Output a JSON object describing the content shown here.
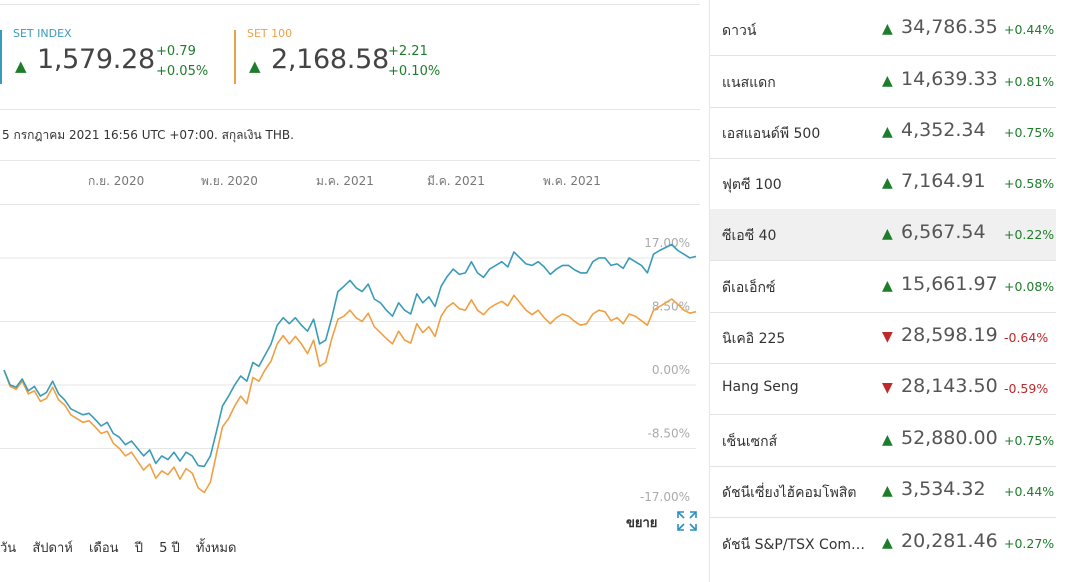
{
  "header": {
    "indices": [
      {
        "name": "SET INDEX",
        "value": "1,579.28",
        "change": "+0.79",
        "change_pct": "+0.05%",
        "color": "#3a9bb8",
        "direction": "up"
      },
      {
        "name": "SET 100",
        "value": "2,168.58",
        "change": "+2.21",
        "change_pct": "+0.10%",
        "color": "#f0a044",
        "direction": "up"
      }
    ],
    "note": "5 กรกฎาคม 2021 16:56 UTC +07:00. สกุลเงิน THB."
  },
  "chart_data": {
    "type": "line",
    "x_tick_labels": [
      "ก.ย. 2020",
      "พ.ย. 2020",
      "ม.ค. 2021",
      "มี.ค. 2021",
      "พ.ค. 2021"
    ],
    "y_tick_labels": [
      "17.00%",
      "8.50%",
      "0.00%",
      "-8.50%",
      "-17.00%"
    ],
    "ylim": [
      -17,
      17
    ],
    "grid": true,
    "series": [
      {
        "name": "SET INDEX",
        "color": "#3a9bb8",
        "values": [
          0.0,
          -2.0,
          -2.3,
          -1.2,
          -2.8,
          -2.2,
          -3.5,
          -3.0,
          -1.5,
          -3.2,
          -4.0,
          -5.2,
          -5.6,
          -6.0,
          -5.8,
          -6.6,
          -7.5,
          -7.0,
          -8.5,
          -9.0,
          -10.0,
          -9.5,
          -10.5,
          -11.5,
          -10.7,
          -12.5,
          -11.5,
          -12.0,
          -11.0,
          -12.2,
          -11.0,
          -11.5,
          -12.8,
          -12.9,
          -11.5,
          -8.2,
          -4.8,
          -3.5,
          -2.0,
          -0.8,
          -1.5,
          1.0,
          0.5,
          2.0,
          3.5,
          6.0,
          7.0,
          6.2,
          7.0,
          6.0,
          5.2,
          6.8,
          3.5,
          4.0,
          7.0,
          10.5,
          11.2,
          12.0,
          11.0,
          10.5,
          11.5,
          9.5,
          9.0,
          8.0,
          7.2,
          9.0,
          8.0,
          7.5,
          10.2,
          9.0,
          9.8,
          8.5,
          11.2,
          12.5,
          13.5,
          12.8,
          13.0,
          14.5,
          13.0,
          12.4,
          13.5,
          14.0,
          14.5,
          13.8,
          15.8,
          15.0,
          14.2,
          14.0,
          14.5,
          13.8,
          12.8,
          13.5,
          14.0,
          14.0,
          13.4,
          13.0,
          13.0,
          14.5,
          15.0,
          15.0,
          14.0,
          14.2,
          13.6,
          15.0,
          14.5,
          14.0,
          13.0,
          15.5,
          16.0,
          16.4,
          16.8,
          16.0,
          15.5,
          15.0,
          15.2
        ]
      },
      {
        "name": "SET 100",
        "color": "#f0a044",
        "values": [
          0.0,
          -2.2,
          -2.6,
          -1.5,
          -3.2,
          -2.8,
          -4.2,
          -3.8,
          -2.3,
          -4.0,
          -4.7,
          -6.0,
          -6.5,
          -7.0,
          -6.8,
          -7.6,
          -8.5,
          -8.2,
          -9.8,
          -10.5,
          -11.5,
          -11.0,
          -12.2,
          -13.4,
          -12.6,
          -14.5,
          -13.5,
          -14.0,
          -13.0,
          -14.6,
          -13.2,
          -13.8,
          -15.8,
          -16.4,
          -15.0,
          -11.2,
          -7.6,
          -6.5,
          -4.8,
          -3.5,
          -4.5,
          -1.0,
          -1.5,
          0.0,
          1.2,
          3.5,
          4.6,
          3.5,
          4.5,
          3.5,
          2.2,
          4.0,
          0.5,
          1.0,
          4.2,
          6.8,
          7.2,
          8.0,
          7.0,
          6.5,
          7.6,
          5.8,
          5.0,
          4.2,
          3.5,
          5.2,
          4.0,
          3.6,
          6.2,
          5.0,
          5.8,
          4.5,
          7.2,
          8.4,
          9.0,
          8.2,
          8.0,
          9.4,
          8.0,
          7.4,
          8.3,
          8.8,
          9.2,
          8.6,
          10.0,
          9.0,
          8.0,
          7.4,
          8.0,
          7.0,
          6.2,
          7.0,
          7.5,
          7.2,
          6.5,
          6.0,
          6.2,
          7.5,
          8.0,
          7.8,
          6.6,
          7.0,
          6.2,
          7.5,
          7.2,
          6.6,
          6.0,
          8.0,
          8.5,
          9.0,
          9.5,
          8.8,
          8.0,
          7.6,
          7.8
        ]
      }
    ]
  },
  "expand": {
    "label": "ขยาย"
  },
  "ranges": [
    "วัน",
    "สัปดาห์",
    "เดือน",
    "ปี",
    "5 ปี",
    "ทั้งหมด"
  ],
  "markets": [
    {
      "name": "ดาวน์",
      "price": "34,786.35",
      "change": "+0.44%",
      "direction": "up"
    },
    {
      "name": "แนสแดก",
      "price": "14,639.33",
      "change": "+0.81%",
      "direction": "up"
    },
    {
      "name": "เอสแอนด์พี 500",
      "price": "4,352.34",
      "change": "+0.75%",
      "direction": "up"
    },
    {
      "name": "ฟุตซี 100",
      "price": "7,164.91",
      "change": "+0.58%",
      "direction": "up"
    },
    {
      "name": "ซีเอซี 40",
      "price": "6,567.54",
      "change": "+0.22%",
      "direction": "up"
    },
    {
      "name": "ดีเอเอ็กซ์",
      "price": "15,661.97",
      "change": "+0.08%",
      "direction": "up"
    },
    {
      "name": "นิเคอิ 225",
      "price": "28,598.19",
      "change": "-0.64%",
      "direction": "down"
    },
    {
      "name": "Hang Seng",
      "price": "28,143.50",
      "change": "-0.59%",
      "direction": "down"
    },
    {
      "name": "เซ็นเซกส์",
      "price": "52,880.00",
      "change": "+0.75%",
      "direction": "up"
    },
    {
      "name": "ดัชนีเซี่ยงไฮ้คอมโพสิต",
      "price": "3,534.32",
      "change": "+0.44%",
      "direction": "up"
    },
    {
      "name": "ดัชนี S&P/TSX Com…",
      "price": "20,281.46",
      "change": "+0.27%",
      "direction": "up"
    }
  ]
}
